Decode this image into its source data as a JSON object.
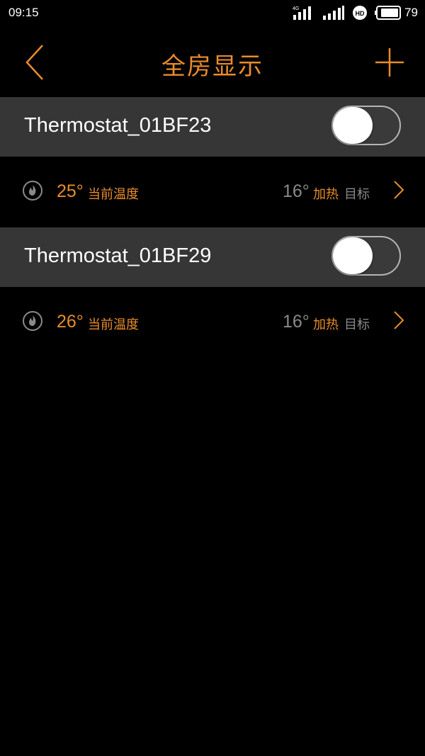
{
  "status_bar": {
    "time": "09:15",
    "network_type": "4G",
    "hd_badge": "HD",
    "battery_level": "79"
  },
  "header": {
    "title": "全房显示",
    "back_icon": "chevron-left-icon",
    "add_icon": "plus-icon"
  },
  "colors": {
    "accent": "#e98c2b",
    "row_background": "#363636",
    "muted_text": "#8a8a8a",
    "background": "#000000"
  },
  "devices": [
    {
      "name": "Thermostat_01BF23",
      "power_on": false,
      "current_temp": "25°",
      "current_label": "当前温度",
      "target_temp": "16°",
      "mode": "加热",
      "target_label": "目标"
    },
    {
      "name": "Thermostat_01BF29",
      "power_on": false,
      "current_temp": "26°",
      "current_label": "当前温度",
      "target_temp": "16°",
      "mode": "加热",
      "target_label": "目标"
    }
  ]
}
